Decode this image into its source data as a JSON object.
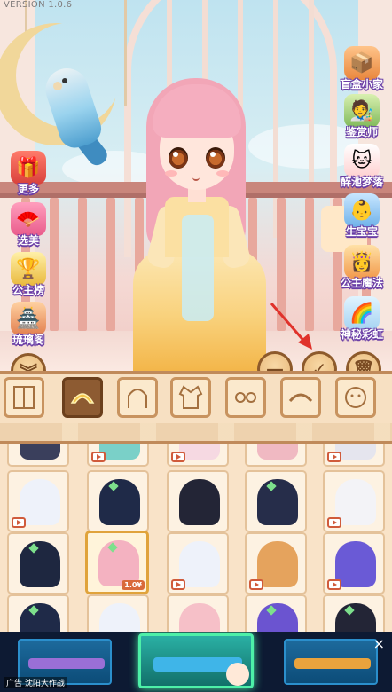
{
  "version": "VERSION 1.0.6",
  "left_menu": [
    {
      "label": "更多",
      "icon": "gift-icon"
    },
    {
      "label": "选美",
      "icon": "fan-icon"
    },
    {
      "label": "公主榜",
      "icon": "podium-icon"
    },
    {
      "label": "琉璃阁",
      "icon": "pavilion-icon"
    }
  ],
  "right_menu": [
    {
      "label": "盲盒小家",
      "icon": "blindbox-icon"
    },
    {
      "label": "鉴赏师",
      "icon": "appraiser-icon"
    },
    {
      "label": "醉池梦落",
      "icon": "cat-icon"
    },
    {
      "label": "生宝宝",
      "icon": "baby-icon"
    },
    {
      "label": "公主魔法",
      "icon": "magic-icon"
    },
    {
      "label": "神秘彩虹",
      "icon": "rainbow-icon"
    }
  ],
  "actions": {
    "minus": "—",
    "confirm": "✓",
    "delete": "🗑",
    "expand": "︾"
  },
  "tabs": [
    {
      "name": "background",
      "active": false
    },
    {
      "name": "hair-front",
      "active": true
    },
    {
      "name": "hair-back",
      "active": false
    },
    {
      "name": "outfit",
      "active": false
    },
    {
      "name": "eyes",
      "active": false
    },
    {
      "name": "eyebrows",
      "active": false
    },
    {
      "name": "face",
      "active": false
    }
  ],
  "grid_badge_price": "1.0¥",
  "ad": {
    "label": "广告 沈阳大作战",
    "close": "×"
  },
  "colors": {
    "accent": "#8d5b32",
    "selected_border": "#e0a33b",
    "label_outline": "#6a3ea6"
  }
}
